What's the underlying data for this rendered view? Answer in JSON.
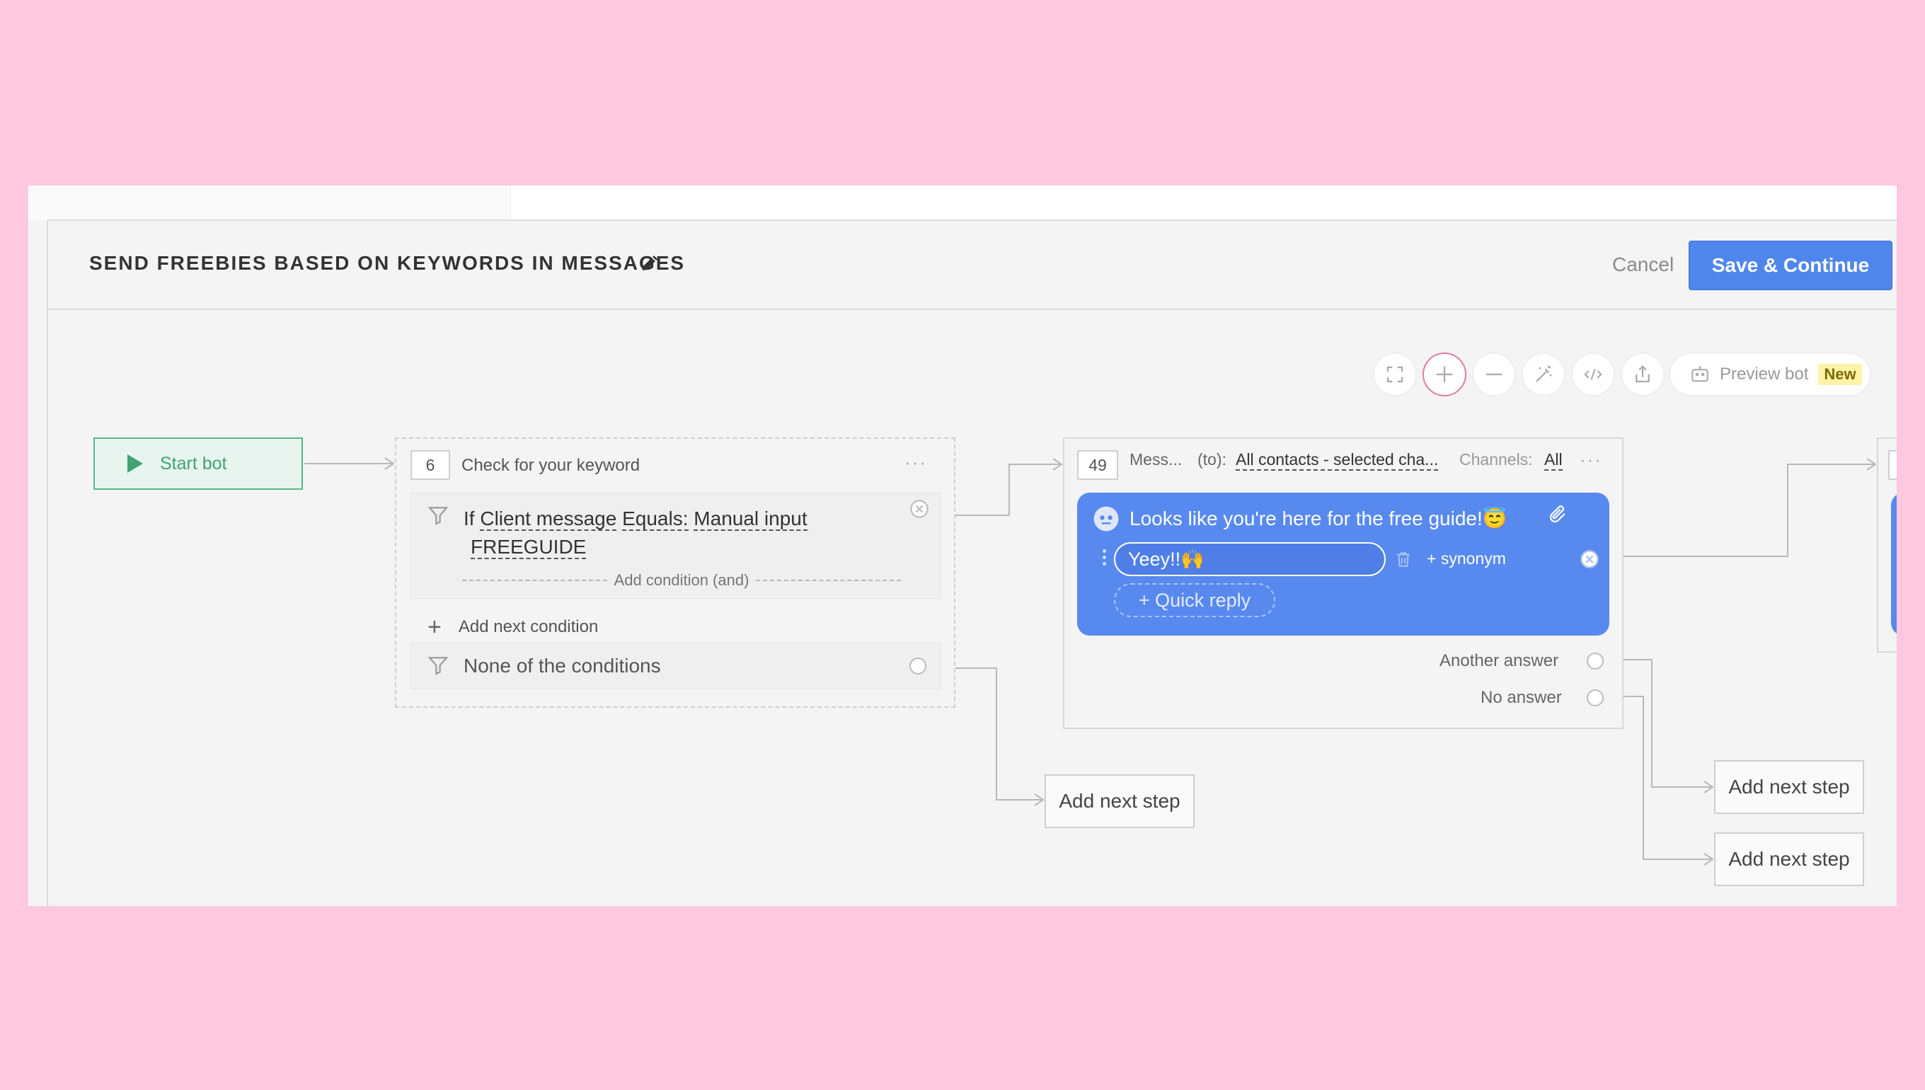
{
  "header": {
    "title": "SEND FREEBIES BASED ON KEYWORDS IN MESSAGES",
    "cancel_label": "Cancel",
    "save_label": "Save & Continue"
  },
  "toolbar": {
    "preview_label": "Preview bot",
    "preview_badge": "New",
    "icons": [
      "fullscreen-icon",
      "zoom-in-icon",
      "zoom-out-icon",
      "magic-wand-icon",
      "code-icon",
      "export-icon",
      "bot-icon"
    ]
  },
  "start_node": {
    "label": "Start bot"
  },
  "condition_node": {
    "number": "6",
    "title": "Check for your keyword",
    "menu": "···",
    "condition": {
      "prefix": "If",
      "field": "Client message",
      "operator": "Equals:",
      "source": "Manual input",
      "value": "FREEGUIDE"
    },
    "add_condition_and": "Add condition (and)",
    "add_next_condition": "Add next condition",
    "none_label": "None of the conditions"
  },
  "message_node": {
    "number": "49",
    "title": "Mess...",
    "to_label": "(to):",
    "to_value": "All contacts - selected cha...",
    "channels_label": "Channels:",
    "channels_value": "All",
    "menu": "···",
    "message_text": "Looks like you're here for the free guide!😇",
    "quick_reply_value": "Yeey!!🙌",
    "synonym_label": "+ synonym",
    "add_quick_reply": "+ Quick reply",
    "another_answer": "Another answer",
    "no_answer": "No answer"
  },
  "add_next_step": {
    "label": "Add next step"
  },
  "colors": {
    "background": "#ffc8df",
    "primary": "#4f86ec",
    "bubble": "#5889ee",
    "start_green": "#3fa373"
  }
}
